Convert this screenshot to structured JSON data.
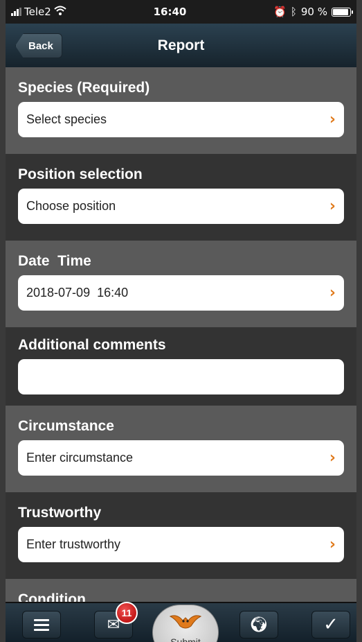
{
  "status_bar": {
    "carrier": "Tele2",
    "time": "16:40",
    "battery": "90 %",
    "icons": [
      "signal-icon",
      "wifi-icon",
      "alarm-icon",
      "bluetooth-icon",
      "battery-icon"
    ]
  },
  "nav": {
    "back_label": "Back",
    "title": "Report"
  },
  "sections": [
    {
      "label": "Species (Required)",
      "value": "Select species"
    },
    {
      "label": "Position selection",
      "value": "Choose position"
    },
    {
      "label": "Date  Time",
      "value": "2018-07-09  16:40"
    },
    {
      "label": "Additional comments",
      "value": ""
    },
    {
      "label": "Circumstance",
      "value": "Enter circumstance"
    },
    {
      "label": "Trustworthy",
      "value": "Enter trustworthy"
    },
    {
      "label": "Condition",
      "value": ""
    }
  ],
  "tab_bar": {
    "badge_count": "11",
    "submit_label": "Submit"
  },
  "colors": {
    "accent": "#e07a1c",
    "nav_bg": "#1e2f3a",
    "badge": "#d01010"
  }
}
